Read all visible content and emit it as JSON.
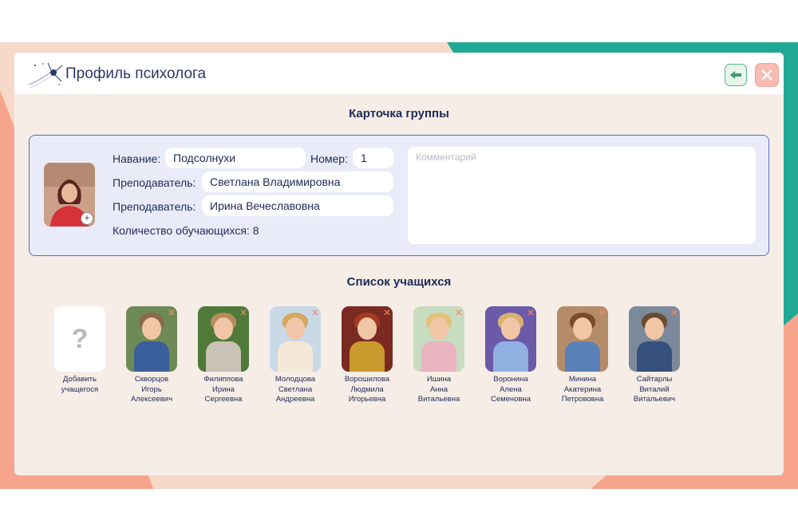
{
  "header": {
    "title": "Профиль психолога"
  },
  "card": {
    "section_title": "Карточка группы",
    "name_label": "Навание:",
    "name_value": "Подсолнухи",
    "number_label": "Номер:",
    "number_value": "1",
    "teacher1_label": "Преподаватель:",
    "teacher1_value": "Светлана Владимировна",
    "teacher2_label": "Преподаватель:",
    "teacher2_value": "Ирина Вечеславовна",
    "count_text": "Количество обучающихся: 8",
    "comment_placeholder": "Комментарий"
  },
  "students_section": {
    "title": "Список учащихся",
    "add": {
      "icon": "?",
      "label_line1": "Добавить",
      "label_line2": "учащегося"
    },
    "items": [
      {
        "last": "Скворцов",
        "first": "Игорь",
        "middle": "Алексеевич"
      },
      {
        "last": "Филиппова",
        "first": "Ирина",
        "middle": "Сергеевна"
      },
      {
        "last": "Молодцова",
        "first": "Светлана",
        "middle": "Андреевна"
      },
      {
        "last": "Ворошилова",
        "first": "Людмила",
        "middle": "Игорьевна"
      },
      {
        "last": "Ишина",
        "first": "Анна",
        "middle": "Витальевна"
      },
      {
        "last": "Воронина",
        "first": "Алена",
        "middle": "Семеновна"
      },
      {
        "last": "Минина",
        "first": "Акатерина",
        "middle": "Петрововна"
      },
      {
        "last": "Сайтарлы",
        "first": "Виталий",
        "middle": "Витальевич"
      }
    ]
  },
  "colors": {
    "accent_navy": "#1d2a57",
    "teal": "#21a995",
    "salmon": "#f7a48d",
    "card_border": "#5a6bc8"
  }
}
